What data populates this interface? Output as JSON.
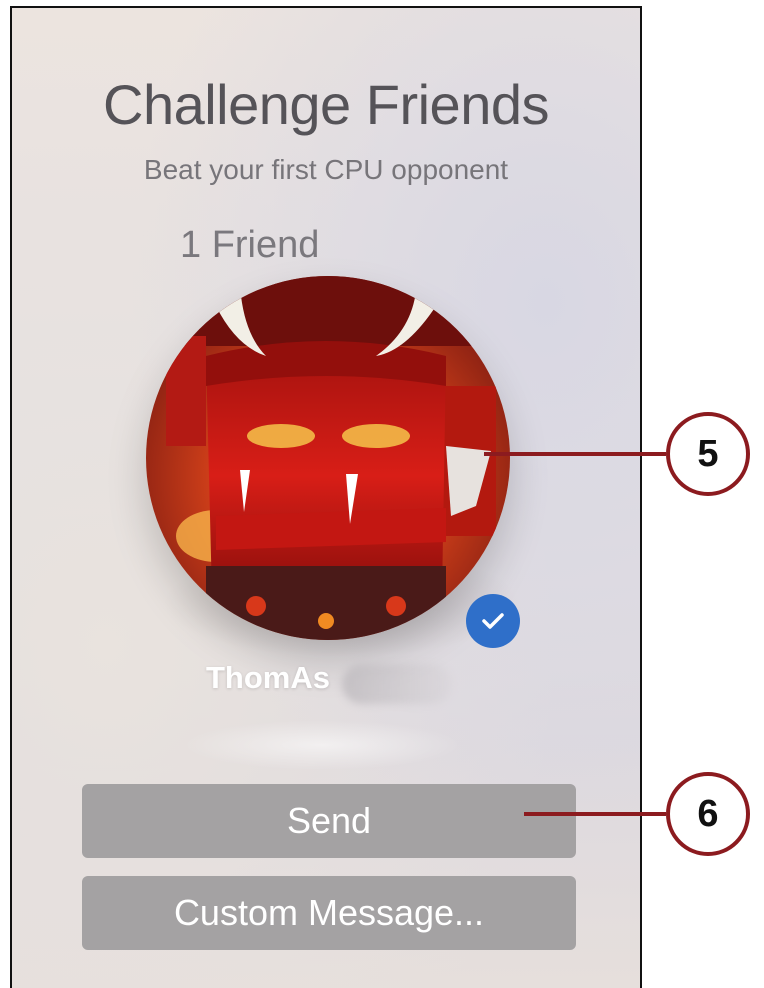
{
  "screen": {
    "title": "Challenge Friends",
    "subtitle": "Beat your first CPU opponent",
    "friend_count_label": "1 Friend"
  },
  "friend": {
    "name": "ThomAs",
    "avatar_icon": "devil-avatar-icon",
    "selected": true,
    "selected_icon": "checkmark-icon",
    "selected_color": "#2f6fc9"
  },
  "buttons": {
    "send_label": "Send",
    "custom_message_label": "Custom Message..."
  },
  "callouts": [
    {
      "number": "5"
    },
    {
      "number": "6"
    }
  ],
  "colors": {
    "button_bg": "#a4a2a3",
    "callout_red": "#8c1b1f"
  }
}
